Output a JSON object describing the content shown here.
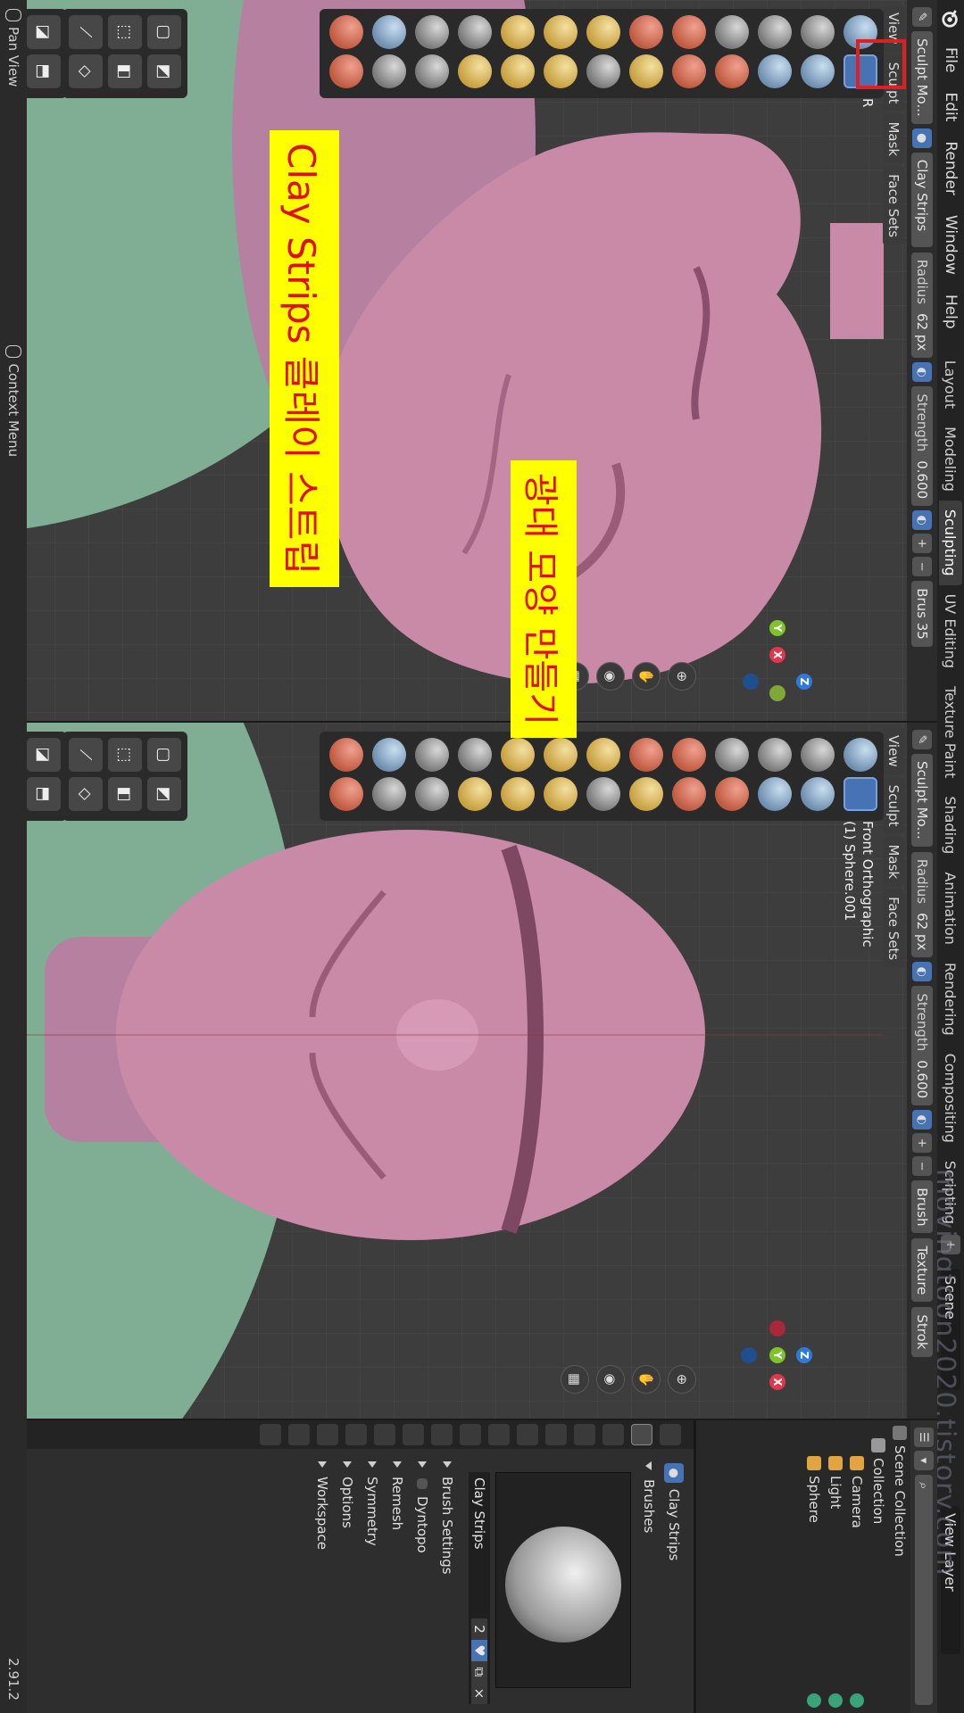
{
  "topbar": {
    "menus": [
      "File",
      "Edit",
      "Render",
      "Window",
      "Help"
    ],
    "workspaces": [
      "Layout",
      "Modeling",
      "Sculpting",
      "UV Editing",
      "Texture Paint",
      "Shading",
      "Animation",
      "Rendering",
      "Compositing",
      "Scripting"
    ],
    "active_workspace": "Sculpting",
    "plus": "+",
    "scene_label": "Scene",
    "view_layer_label": "View Layer"
  },
  "left_viewport": {
    "mode_label": "Sculpt Mo...",
    "brush_name": "Clay Strips",
    "radius_label": "Radius",
    "radius_value": "62 px",
    "strength_label": "Strength",
    "strength_value": "0.600",
    "brush_label": "Brus",
    "brush_count": "35",
    "menus": [
      "View",
      "Sculpt",
      "Mask",
      "Face Sets"
    ],
    "info_line": "R"
  },
  "right_viewport": {
    "mode_label": "Sculpt Mo...",
    "radius_label": "Radius",
    "radius_value": "62 px",
    "strength_label": "Strength",
    "strength_value": "0.600",
    "brush_label": "Brush",
    "texture_label": "Texture",
    "stroke_label": "Strok",
    "menus": [
      "View",
      "Sculpt",
      "Mask",
      "Face Sets"
    ],
    "info_view": "Front Orthographic",
    "info_object": "(1) Sphere.001"
  },
  "gizmo_axes": {
    "x": "X",
    "y": "Y",
    "z": "Z"
  },
  "outliner": {
    "root": "Scene Collection",
    "collection": "Collection",
    "items": [
      "Camera",
      "Light",
      "Sphere"
    ]
  },
  "properties": {
    "brush_title": "Clay Strips",
    "brushes_section": "Brushes",
    "brush_name": "Clay Strips",
    "brush_users": "2",
    "close": "×",
    "sections": [
      "Brush Settings",
      "Dyntopo",
      "Remesh",
      "Symmetry",
      "Options",
      "Workspace"
    ]
  },
  "status": {
    "left": "Pan View",
    "middle": "Context Menu",
    "version": "2.91.2"
  },
  "annotations": {
    "main": "Clay Strips 클레이 스트립",
    "sub": "광대 모양 만들기"
  },
  "watermark": "movingtoon2020.tistory.com",
  "colors": {
    "accent": "#4772b3",
    "annotation_bg": "#ffff00",
    "annotation_text": "#e01010",
    "mesh_pink": "#c98aa8",
    "mesh_green": "#7fae94"
  }
}
